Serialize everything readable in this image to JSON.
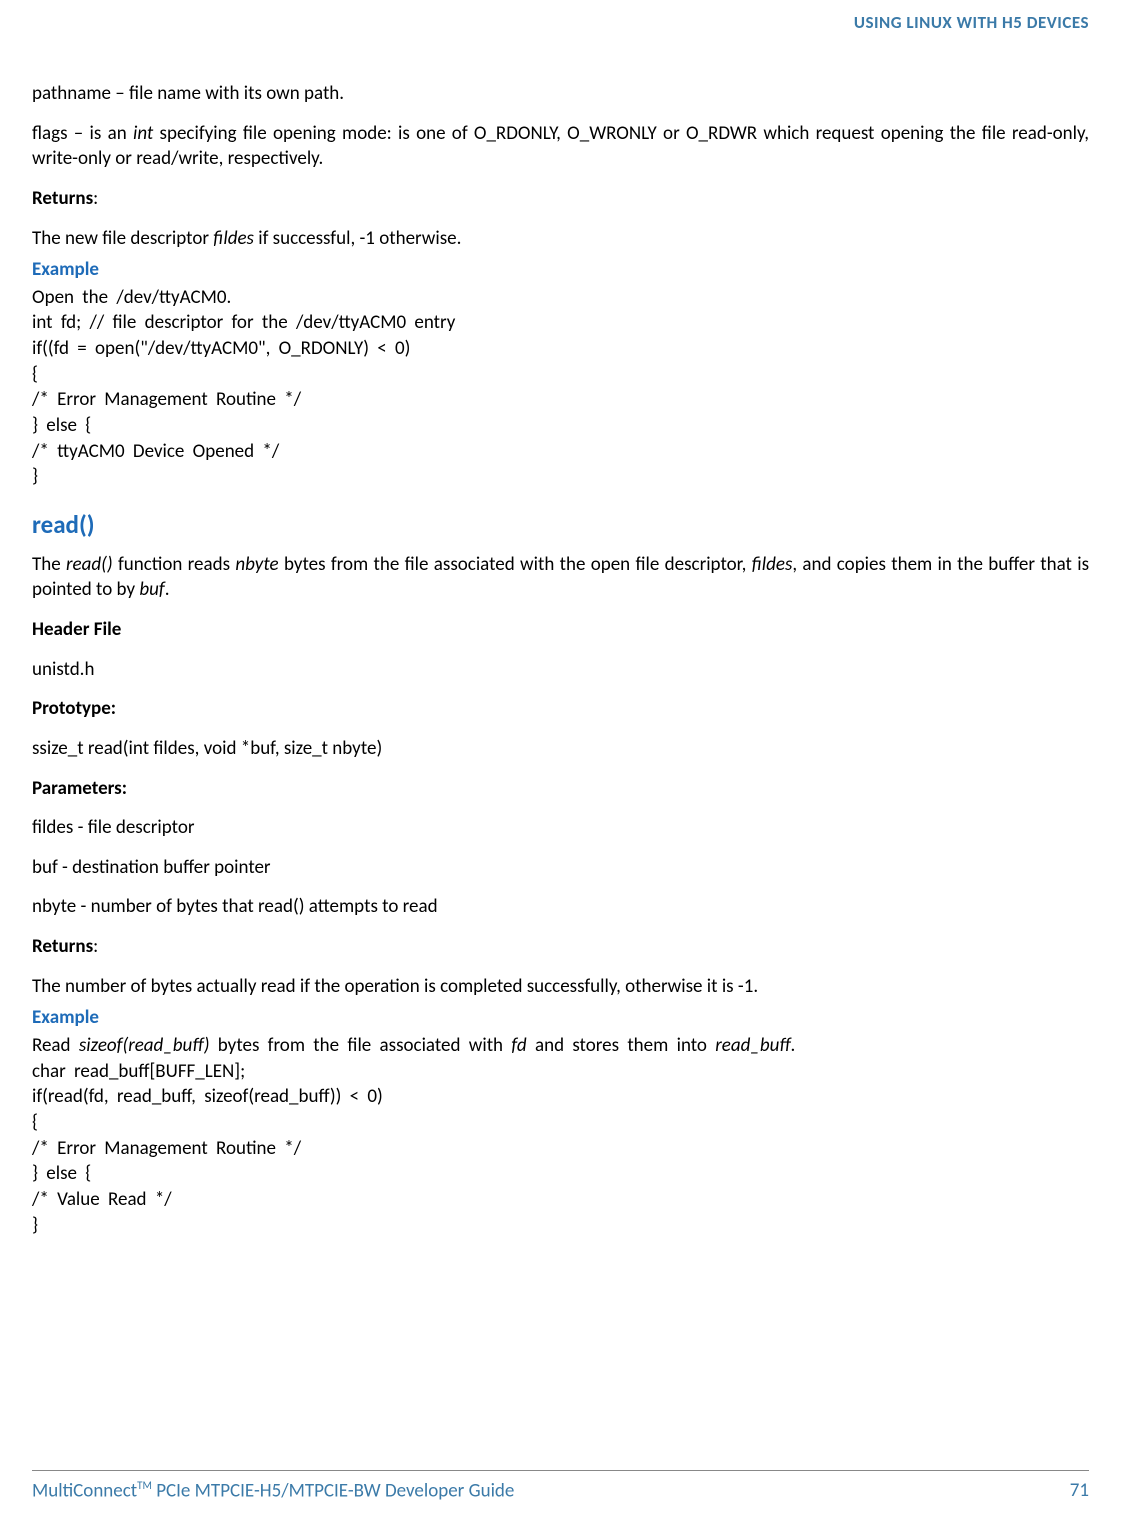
{
  "header": {
    "title": "USING LINUX WITH H5 DEVICES"
  },
  "body": {
    "p1_pathname": "pathname – file name with its own path.",
    "p2_flags_pre": "flags – is an ",
    "p2_flags_italic": "int",
    "p2_flags_post": " specifying file opening mode: is one of O_RDONLY, O_WRONLY or O_RDWR which request opening the file read-only, write-only or read/write, respectively.",
    "returns_label": "Returns",
    "colon": ":",
    "p3_pre": "The new file descriptor ",
    "p3_italic": "fildes",
    "p3_post": " if successful, -1 otherwise.",
    "example_label": "Example",
    "code1_line1": "Open  the  /dev/ttyACM0.",
    "code1_rest": "int  fd;  //  file  descriptor  for  the  /dev/ttyACM0  entry\nif((fd  =  open(\"/dev/ttyACM0\",  O_RDONLY)  <  0)\n{\n/*  Error  Management  Routine  */\n}  else  {\n/*  ttyACM0  Device  Opened  */\n}",
    "read_title": "read()",
    "read_p1_a": "The ",
    "read_p1_b": "read()",
    "read_p1_c": " function reads ",
    "read_p1_d": "nbyte",
    "read_p1_e": " bytes from the file associated with the open file descriptor, ",
    "read_p1_f": "fildes",
    "read_p1_g": ", and copies them in the buffer that is pointed to by ",
    "read_p1_h": "buf",
    "read_p1_i": ".",
    "header_file_label": "Header File",
    "header_file_value": "unistd.h",
    "prototype_label": "Prototype:",
    "prototype_value": "ssize_t read(int fildes, void *buf, size_t nbyte)",
    "parameters_label": "Parameters:",
    "param1": "fildes - file descriptor",
    "param2": "buf - destination buffer pointer",
    "param3": "nbyte - number of bytes that read() attempts to read",
    "returns2_text": "The number of bytes actually read if the operation is completed successfully, otherwise it is -1.",
    "code2_line1_a": "Read  ",
    "code2_line1_b": "sizeof(read_buff)",
    "code2_line1_c": "  bytes  from  the  file  associated  with  ",
    "code2_line1_d": "fd",
    "code2_line1_e": "  and  stores  them  into  ",
    "code2_line1_f": "read_buff",
    "code2_line1_g": ".",
    "code2_rest": "char  read_buff[BUFF_LEN];\nif(read(fd,  read_buff,  sizeof(read_buff))  <  0)\n{\n/*  Error  Management  Routine  */\n}  else  {\n/*  Value  Read  */\n}"
  },
  "footer": {
    "left_a": "MultiConnect",
    "left_tm": "TM",
    "left_b": " PCIe MTPCIE-H5/MTPCIE-BW Developer Guide",
    "page": "71"
  }
}
